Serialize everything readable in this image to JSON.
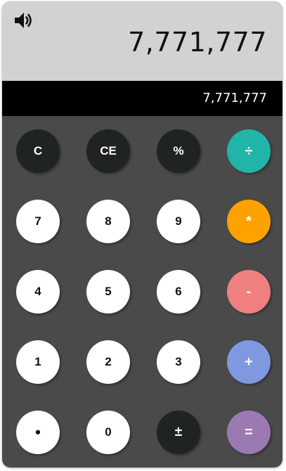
{
  "display": {
    "speaker_icon": "speaker-volume-icon",
    "value": "7,771,777",
    "history": "7,771,777"
  },
  "colors": {
    "display_bg": "#d2d2d2",
    "history_bg": "#000000",
    "keypad_bg": "#4a4a4a",
    "dark_key": "#1f2323",
    "light_key": "#ffffff",
    "divide": "#20b5a8",
    "multiply": "#ffa200",
    "subtract": "#f08080",
    "add": "#7f98e0",
    "equals": "#9b7ab4"
  },
  "keys": {
    "clear": "C",
    "clear_entry": "CE",
    "percent": "%",
    "divide": "÷",
    "seven": "7",
    "eight": "8",
    "nine": "9",
    "multiply": "*",
    "four": "4",
    "five": "5",
    "six": "6",
    "subtract": "-",
    "one": "1",
    "two": "2",
    "three": "3",
    "add": "+",
    "decimal": "•",
    "zero": "0",
    "negate": "±",
    "equals": "="
  }
}
